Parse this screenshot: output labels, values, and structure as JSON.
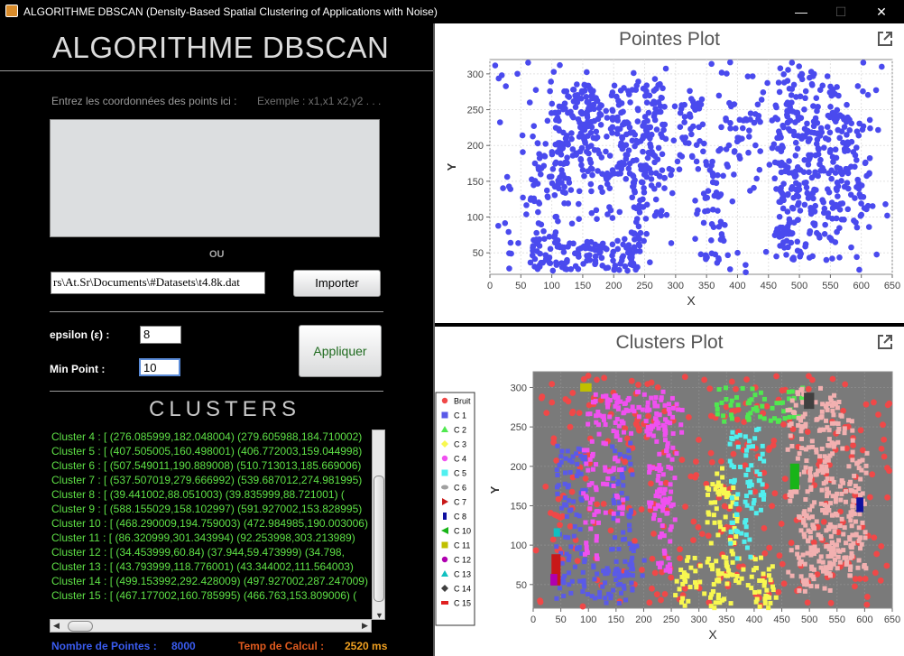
{
  "window": {
    "title": "ALGORITHME DBSCAN (Density-Based Spatial Clustering of Applications with Noise)",
    "minimize": "—",
    "maximize": "☐",
    "close": "✕"
  },
  "left": {
    "app_title": "ALGORITHME DBSCAN",
    "instructions": "Entrez les coordonnées des points ici :",
    "example": "Exemple : x1,x1  x2,y2  . . .",
    "coords_value": "",
    "ou": "OU",
    "file_path": "rs\\At.Sr\\Documents\\#Datasets\\t4.8k.dat",
    "import_button": "Importer",
    "epsilon_label": "epsilon (ε)    :",
    "epsilon_value": "8",
    "minpoint_label": "Min Point    :",
    "minpoint_value": "10",
    "apply_button": "Appliquer",
    "clusters_title": "CLUSTERS",
    "cluster_rows": [
      "Cluster 4 :    [   (276.085999,182.048004)  (279.605988,184.710002)",
      "Cluster 5 :    [   (407.505005,160.498001)  (406.772003,159.044998)",
      "Cluster 6 :    [   (507.549011,190.889008)  (510.713013,185.669006)",
      "Cluster 7 :    [   (537.507019,279.666992)  (539.687012,274.981995)",
      "Cluster 8 :    [   (39.441002,88.051003)  (39.835999,88.721001)  (",
      "Cluster 9 :    [   (588.155029,158.102997)  (591.927002,153.828995)",
      "Cluster 10 :    [   (468.290009,194.759003)  (472.984985,190.003006)",
      "Cluster 11 :    [   (86.320999,301.343994)  (92.253998,303.213989)",
      "Cluster 12 :    [   (34.453999,60.84)  (37.944,59.473999)  (34.798,",
      "Cluster 13 :    [   (43.793999,118.776001)  (43.344002,111.564003)",
      "Cluster 14 :    [   (499.153992,292.428009)  (497.927002,287.247009)",
      "Cluster 15 :    [   (467.177002,160.785995)  (466.763,153.809006)  ("
    ],
    "nb_points_label": "Nombre de Pointes  :",
    "nb_points_value": "8000",
    "calc_time_label": "Temp de Calcul :",
    "calc_time_value": "2520 ms"
  },
  "colors": {
    "points_plot": "#4a4aee",
    "noise": "#f04848"
  },
  "chart_data": [
    {
      "type": "scatter",
      "title": "Pointes Plot",
      "xlabel": "X",
      "ylabel": "Y",
      "xlim": [
        0,
        650
      ],
      "ylim": [
        20,
        320
      ],
      "xticks": [
        "0",
        "50",
        "100",
        "150",
        "200",
        "250",
        "300",
        "350",
        "400",
        "450",
        "500",
        "550",
        "600",
        "650"
      ],
      "yticks": [
        "50",
        "100",
        "150",
        "200",
        "250",
        "300"
      ],
      "grid": true,
      "series": [
        {
          "regions": [
            [
              65,
              110,
              25,
              250
            ],
            [
              65,
              250,
              25,
              70
            ],
            [
              115,
              250,
              25,
              70
            ],
            [
              110,
              135,
              110,
              260
            ],
            [
              110,
              260,
              135,
              290
            ],
            [
              255,
              285,
              100,
              290
            ],
            [
              135,
              185,
              240,
              285
            ],
            [
              140,
              180,
              200,
              280
            ],
            [
              195,
              260,
              200,
              240
            ],
            [
              225,
              255,
              70,
              210
            ],
            [
              250,
              295,
              145,
              170
            ],
            [
              335,
              385,
              160,
              195
            ],
            [
              350,
              375,
              135,
              160
            ],
            [
              345,
              375,
              65,
              135
            ],
            [
              340,
              380,
              40,
              95
            ],
            [
              380,
              440,
              180,
              245
            ],
            [
              295,
              345,
              180,
              270
            ],
            [
              465,
              530,
              40,
              310
            ],
            [
              460,
              500,
              45,
              260
            ],
            [
              515,
              580,
              60,
              285
            ],
            [
              575,
              615,
              90,
              240
            ]
          ]
        }
      ]
    },
    {
      "type": "scatter",
      "title": "Clusters Plot",
      "xlabel": "X",
      "ylabel": "Y",
      "xlim": [
        0,
        650
      ],
      "ylim": [
        20,
        320
      ],
      "xticks": [
        "0",
        "50",
        "100",
        "150",
        "200",
        "250",
        "300",
        "350",
        "400",
        "450",
        "500",
        "550",
        "600",
        "650"
      ],
      "yticks": [
        "50",
        "100",
        "150",
        "200",
        "250",
        "300"
      ],
      "grid": true,
      "legend_position": "left",
      "series": [
        {
          "name": "Bruit",
          "color": "#f04848",
          "marker": "circle"
        },
        {
          "name": "C 1",
          "color": "#5a5ae8",
          "marker": "square"
        },
        {
          "name": "C 2",
          "color": "#50e850",
          "marker": "triangle-up"
        },
        {
          "name": "C 3",
          "color": "#f8f850",
          "marker": "diamond"
        },
        {
          "name": "C 4",
          "color": "#f050f0",
          "marker": "circle"
        },
        {
          "name": "C 5",
          "color": "#50f0f0",
          "marker": "square"
        },
        {
          "name": "C 6",
          "color": "#a0a0a0",
          "marker": "ellipse"
        },
        {
          "name": "C 7",
          "color": "#c81818",
          "marker": "flag"
        },
        {
          "name": "C 8",
          "color": "#1010a0",
          "marker": "rect-tall"
        },
        {
          "name": "C 10",
          "color": "#18b418",
          "marker": "triangle-left"
        },
        {
          "name": "C 11",
          "color": "#c0c000",
          "marker": "square"
        },
        {
          "name": "C 12",
          "color": "#b000b0",
          "marker": "circle"
        },
        {
          "name": "C 13",
          "color": "#10c0c0",
          "marker": "triangle-up"
        },
        {
          "name": "C 14",
          "color": "#404040",
          "marker": "diamond"
        },
        {
          "name": "C 15",
          "color": "#e02020",
          "marker": "rect-wide"
        }
      ]
    }
  ]
}
